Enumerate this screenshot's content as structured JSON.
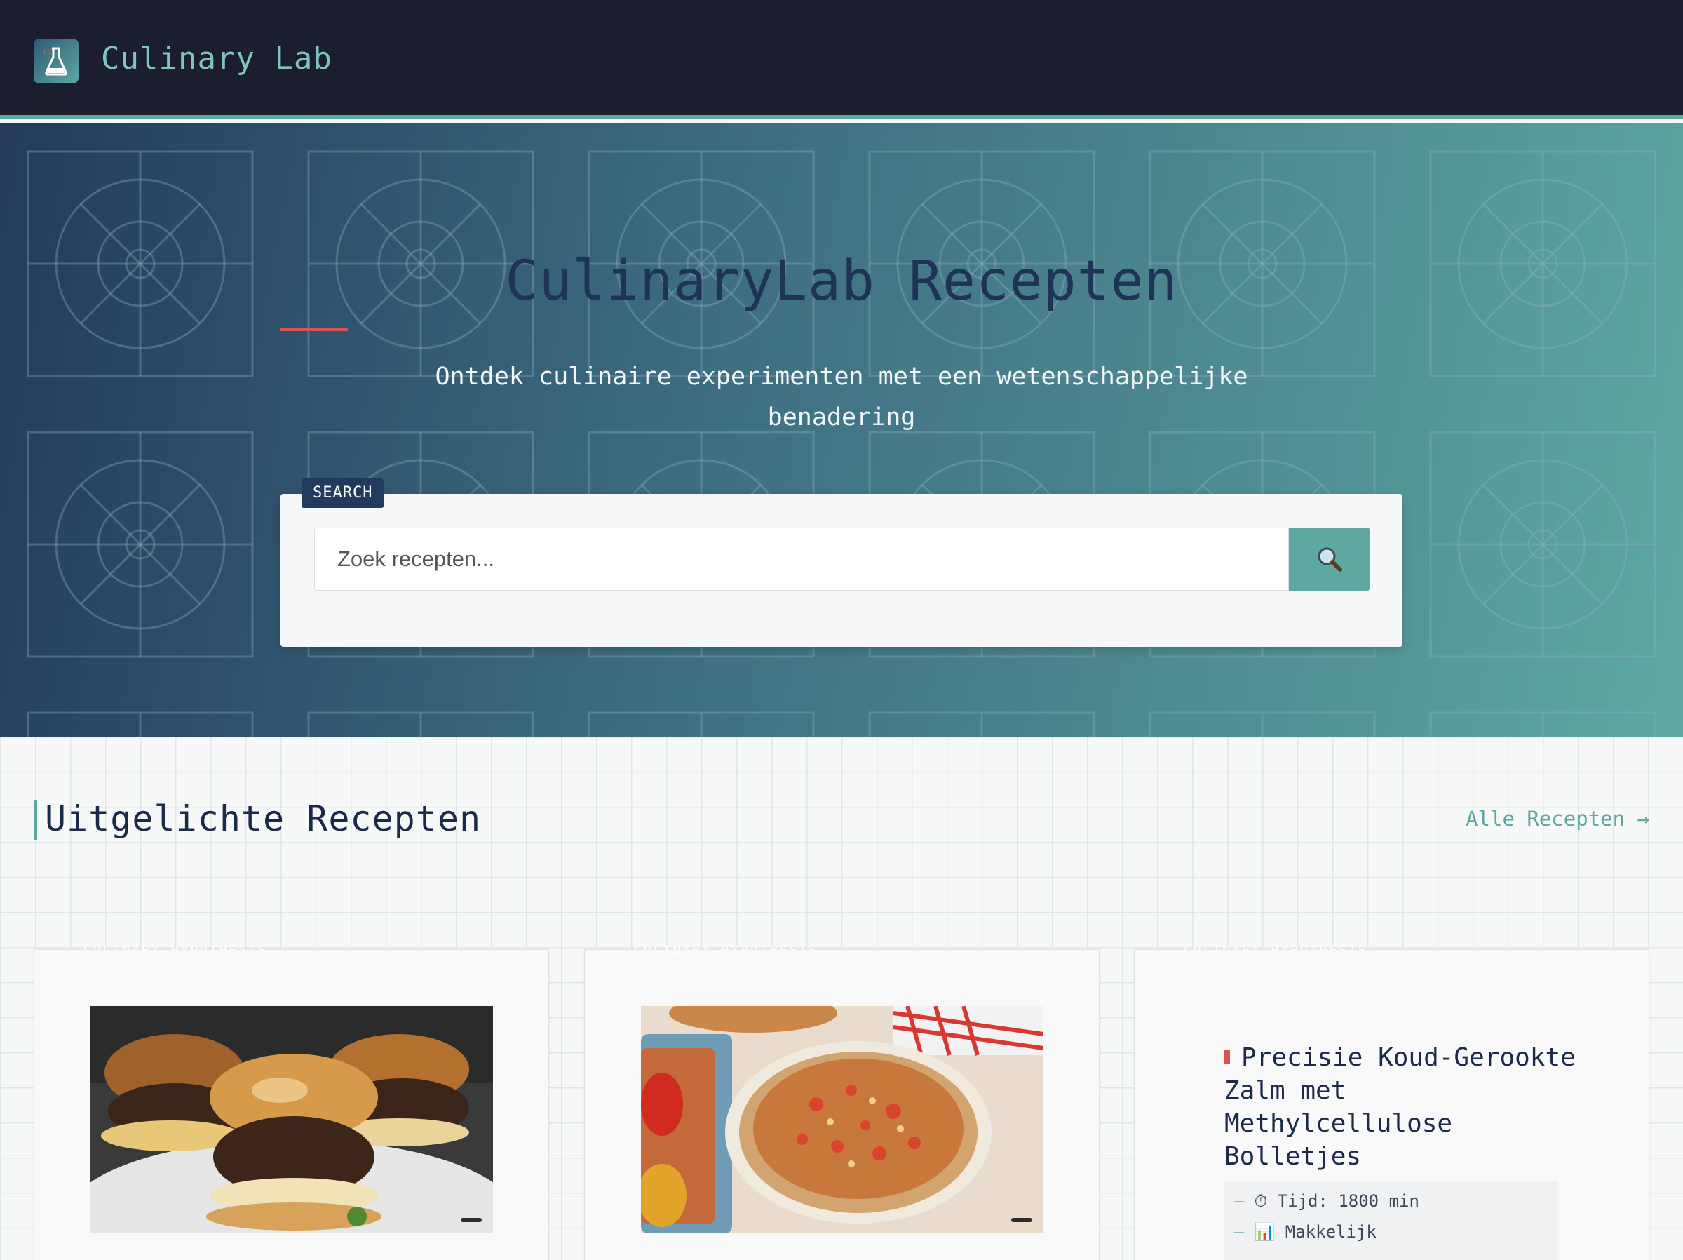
{
  "header": {
    "brand": "Culinary Lab",
    "logo_icon": "flask-icon"
  },
  "hero": {
    "title": "CulinaryLab Recepten",
    "subtitle": "Ontdek culinaire experimenten met een wetenschappelijke benadering",
    "search": {
      "tag": "SEARCH",
      "placeholder": "Zoek recepten...",
      "button_icon": "magnifier-icon"
    }
  },
  "featured": {
    "title": "Uitgelichte Recepten",
    "all_link": "Alle Recepten →",
    "cards": [
      {
        "tag": "CULINARY HYPOTHESIS",
        "image": "sliders-photo"
      },
      {
        "tag": "CULINARY HYPOTHESIS",
        "image": "rice-dish-photo"
      },
      {
        "tag": "CULINARY HYPOTHESIS",
        "title": "Precisie Koud-Gerookte Zalm met Methylcellulose Bolletjes",
        "time": "⏱ Tijd: 1800 min",
        "difficulty": "📊 Makkelijk"
      }
    ]
  },
  "colors": {
    "header_bg": "#1b1e2d",
    "accent": "#5ea8a2",
    "navy": "#233a5c",
    "red": "#d9534f"
  }
}
